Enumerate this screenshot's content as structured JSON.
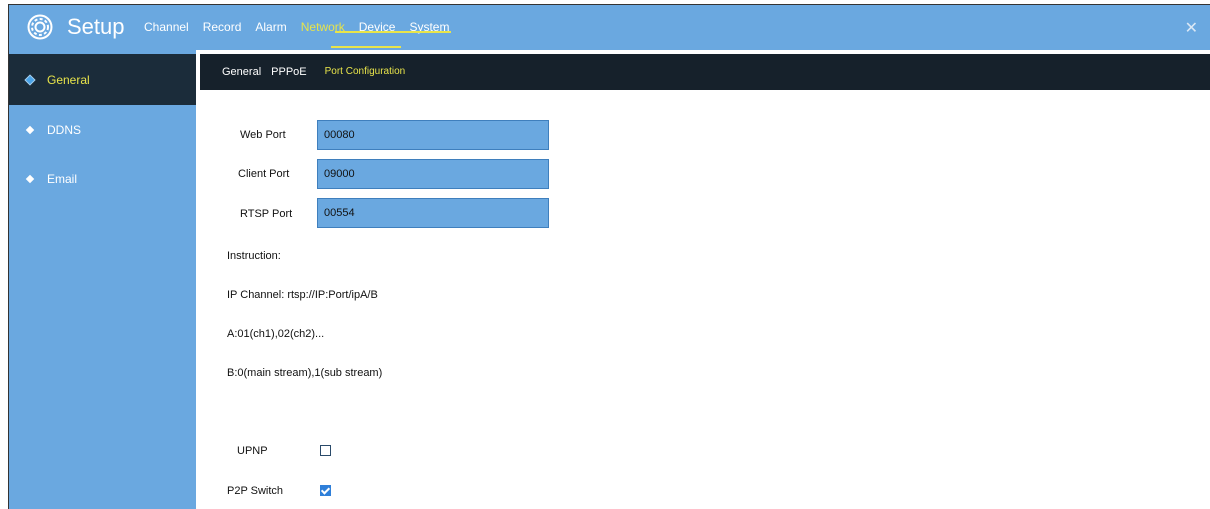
{
  "header": {
    "title": "Setup",
    "nav": [
      {
        "label": "Channel"
      },
      {
        "label": "Record"
      },
      {
        "label": "Alarm"
      },
      {
        "label": "Network",
        "active": true
      },
      {
        "label": "Device"
      },
      {
        "label": "System"
      }
    ],
    "close_icon": "close-icon",
    "settings_icon": "gear-icon"
  },
  "sidebar": {
    "items": [
      {
        "label": "General",
        "active": true
      },
      {
        "label": "DDNS"
      },
      {
        "label": "Email"
      }
    ]
  },
  "subtabs": [
    {
      "label": "General"
    },
    {
      "label": "PPPoE"
    },
    {
      "label": "Port Configuration",
      "active": true
    }
  ],
  "form": {
    "web_port_label": "Web Port",
    "web_port_value": "00080",
    "client_port_label": "Client Port",
    "client_port_value": "09000",
    "rtsp_port_label": "RTSP Port",
    "rtsp_port_value": "00554",
    "instruction": "Instruction:",
    "ip_channel": "IP Channel:  rtsp://IP:Port/ipA/B",
    "a_line": "A:01(ch1),02(ch2)...",
    "b_line": "B:0(main stream),1(sub stream)",
    "upnp_label": "UPNP",
    "upnp_checked": false,
    "p2p_label": "P2P Switch",
    "p2p_checked": true
  },
  "colors": {
    "primary_blue": "#6aa8e0",
    "dark_bar": "#16212b",
    "active_yellow": "#e8e44a"
  }
}
